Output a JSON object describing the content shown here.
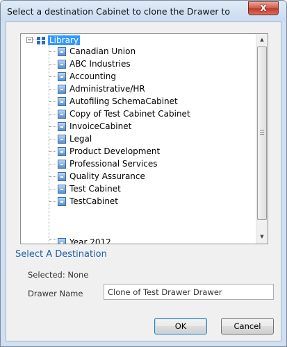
{
  "window": {
    "title": "Select a destination Cabinet to clone the Drawer to",
    "close_glyph": "X"
  },
  "tree": {
    "root": "Library",
    "items": [
      "Canadian Union",
      "ABC Industries",
      "Accounting",
      "Administrative/HR",
      "Autofiling SchemaCabinet",
      "Copy of Test Cabinet Cabinet",
      "InvoiceCabinet",
      "Legal",
      "Product Development",
      "Professional Services",
      "Quality Assurance",
      "Test Cabinet",
      "TestCabinet",
      "Year 2012"
    ],
    "scroll_up_glyph": "▲",
    "scroll_down_glyph": "▼"
  },
  "destination": {
    "heading": "Select A Destination",
    "selected_text": "Selected: None",
    "drawer_label": "Drawer Name",
    "drawer_value": "Clone of Test Drawer Drawer"
  },
  "buttons": {
    "ok": "OK",
    "cancel": "Cancel"
  },
  "colors": {
    "accent": "#3399ff",
    "heading": "#1f5fa8",
    "close": "#c0392b"
  }
}
